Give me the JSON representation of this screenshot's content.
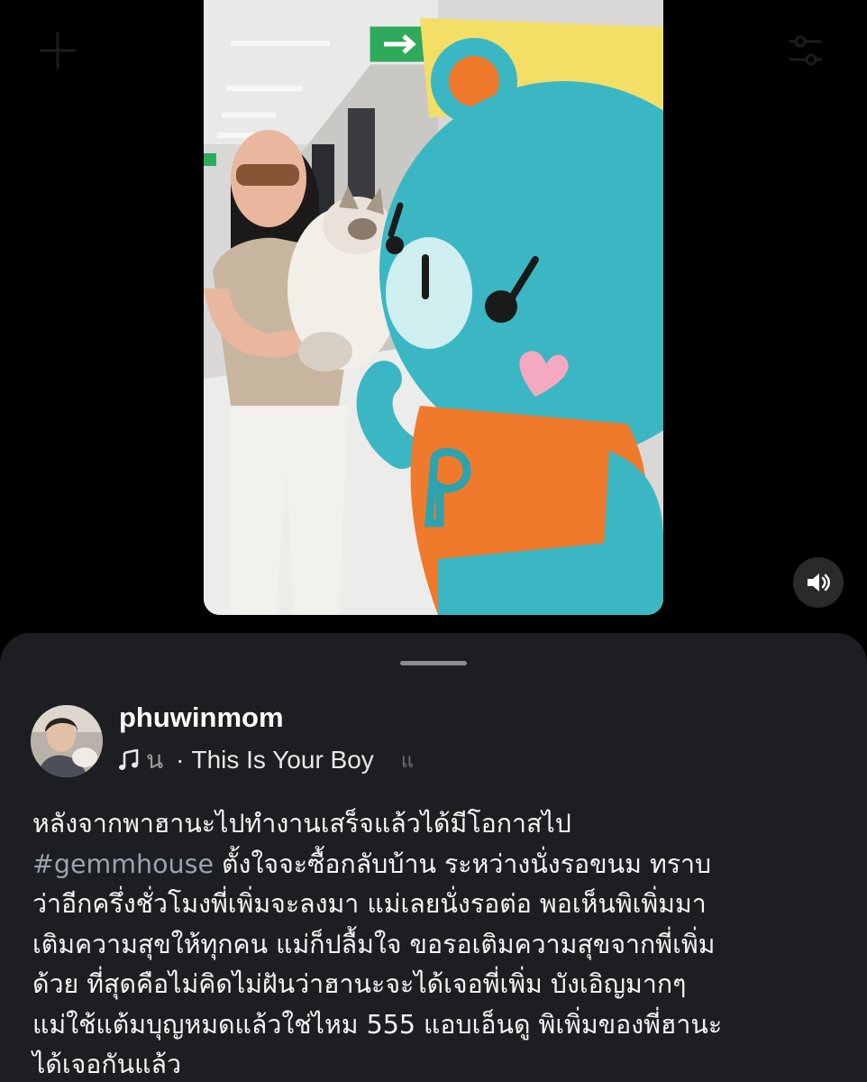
{
  "post": {
    "username": "phuwinmom",
    "music": {
      "icon": "music-note-icon",
      "prev_fragment": "น",
      "separator": "·",
      "title": "This Is Your Boy",
      "next_fragment": "แ"
    },
    "caption": {
      "line1": "หลังจากพาฮานะไปทำงานเสร็จแล้วได้มีโอกาสไป",
      "hashtag": "#gemmhouse",
      "rest": "  ตั้งใจจะซื้อกลับบ้าน ระหว่างนั่งรอขนม ทราบ\nว่าอีกครึ่งชั่วโมงพี่เพิ่มจะลงมา แม่เลยนั่งรอต่อ พอเห็นพิเพิ่มมา\nเติมความสุขให้ทุกคน แม่ก็ปลื้มใจ ขอรอเติมความสุขจากพี่เพิ่ม\nด้วย ที่สุดคือไม่คิดไม่ฝันว่าฮานะจะได้เจอพี่เพิ่ม บังเอิญมากๆ\nแม่ใช้แต้มบุญหมดแล้วใช่ไหม 555 แอบเอ็นดู พิเพิ่มของพี่ฮานะ\nได้เจอกันแล้ว"
    }
  },
  "media": {
    "exit_sign_icon": "exit-sign-icon",
    "mascot_heart_color": "#f5a9c0",
    "mascot_body_color": "#3bb7c4",
    "mascot_shirt_color": "#f07a2b"
  },
  "controls": {
    "volume_icon": "speaker-volume-icon"
  },
  "theme": {
    "sheet_bg": "#1c1e22",
    "hashtag_color": "#9aa3ad"
  }
}
